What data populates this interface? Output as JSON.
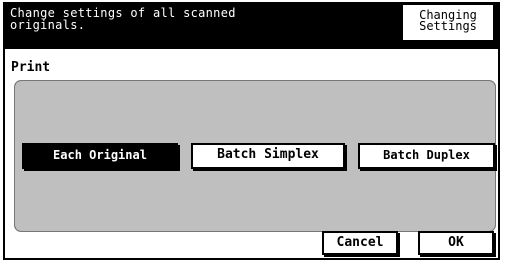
{
  "header": {
    "message": "Change settings of all scanned\noriginals.",
    "mode_tab": "Changing\nSettings"
  },
  "section": {
    "title": "Print"
  },
  "print_options": [
    {
      "label": "Each Original",
      "selected": true
    },
    {
      "label": "Batch Simplex",
      "selected": false
    },
    {
      "label": "Batch Duplex",
      "selected": false
    }
  ],
  "footer": {
    "cancel_label": "Cancel",
    "ok_label": "OK"
  }
}
